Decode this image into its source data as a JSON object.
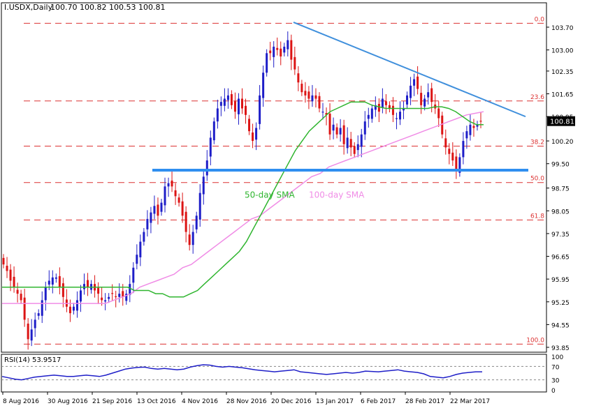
{
  "header": {
    "symbol": "I.USDX,Daily",
    "ohlc": "100.70 100.82 100.53 100.81"
  },
  "colors": {
    "bull": "#1e1ec8",
    "bear": "#dc1414",
    "sma50": "#2fb52f",
    "sma100": "#f08ce6",
    "trendline": "#3f8fdc",
    "support": "#2f8ff0",
    "fib": "#dc3232",
    "rsi": "#1e1ec8",
    "price_tag_bg": "#000000"
  },
  "chart_data": {
    "type": "candlestick",
    "symbol": "I.USDX",
    "timeframe": "Daily",
    "ylim": [
      93.7,
      104.15
    ],
    "y_ticks": [
      "103.70",
      "103.00",
      "102.35",
      "101.65",
      "100.95",
      "100.20",
      "99.50",
      "98.75",
      "98.05",
      "97.35",
      "96.65",
      "95.95",
      "95.25",
      "94.55",
      "93.85"
    ],
    "x_ticks": [
      "8 Aug 2016",
      "30 Aug 2016",
      "21 Sep 2016",
      "13 Oct 2016",
      "4 Nov 2016",
      "28 Nov 2016",
      "20 Dec 2016",
      "13 Jan 2017",
      "6 Feb 2017",
      "28 Feb 2017",
      "22 Mar 2017"
    ],
    "last_price": "100.81",
    "closes": [
      96.4,
      96.2,
      95.9,
      95.7,
      95.5,
      95.3,
      94.7,
      94.1,
      94.4,
      94.7,
      94.9,
      95.3,
      95.7,
      95.9,
      96.0,
      96.0,
      95.7,
      95.4,
      95.1,
      94.9,
      95.1,
      95.3,
      95.6,
      95.8,
      95.7,
      95.8,
      95.6,
      95.5,
      95.3,
      95.3,
      95.4,
      95.5,
      95.4,
      95.5,
      95.4,
      95.5,
      95.8,
      96.3,
      96.7,
      97.1,
      97.4,
      97.8,
      98.0,
      98.2,
      97.9,
      98.3,
      98.8,
      98.9,
      98.8,
      98.5,
      98.3,
      97.9,
      97.4,
      97.0,
      97.4,
      97.9,
      98.6,
      99.1,
      99.6,
      100.3,
      100.8,
      101.2,
      101.4,
      101.5,
      101.6,
      101.3,
      101.1,
      101.5,
      101.2,
      101.0,
      100.5,
      100.2,
      100.6,
      101.6,
      102.3,
      102.9,
      102.9,
      103.1,
      103.0,
      102.8,
      103.1,
      103.3,
      102.7,
      102.4,
      102.0,
      101.7,
      101.6,
      101.5,
      101.6,
      101.5,
      101.2,
      101.1,
      101.0,
      100.4,
      100.7,
      100.4,
      100.6,
      100.1,
      100.3,
      100.0,
      99.8,
      100.1,
      100.4,
      100.8,
      101.0,
      101.2,
      101.3,
      101.1,
      101.5,
      101.3,
      101.2,
      101.0,
      100.9,
      101.1,
      101.2,
      101.6,
      101.9,
      102.1,
      101.8,
      101.3,
      101.5,
      101.7,
      101.4,
      101.2,
      100.9,
      100.4,
      100.0,
      99.8,
      99.6,
      99.3,
      99.7,
      100.2,
      100.5,
      100.7,
      100.6,
      100.7,
      100.81
    ],
    "sma50": [
      95.7,
      95.7,
      95.7,
      95.7,
      95.7,
      95.7,
      95.7,
      95.7,
      95.7,
      95.7,
      95.7,
      95.7,
      95.7,
      95.7,
      95.7,
      95.7,
      95.7,
      95.7,
      95.7,
      95.6,
      95.6,
      95.6,
      95.5,
      95.5,
      95.4,
      95.4,
      95.4,
      95.5,
      95.6,
      95.8,
      96.0,
      96.2,
      96.4,
      96.6,
      96.8,
      97.1,
      97.5,
      97.9,
      98.3,
      98.7,
      99.1,
      99.5,
      99.9,
      100.2,
      100.5,
      100.7,
      100.9,
      101.1,
      101.2,
      101.3,
      101.4,
      101.4,
      101.4,
      101.3,
      101.25,
      101.2,
      101.2,
      101.2,
      101.2,
      101.2,
      101.2,
      101.2,
      101.25,
      101.25,
      101.2,
      101.1,
      100.95,
      100.8,
      100.7,
      100.7
    ],
    "sma100": [
      95.2,
      95.2,
      95.2,
      95.2,
      95.2,
      95.2,
      95.2,
      95.2,
      95.2,
      95.2,
      95.2,
      95.2,
      95.2,
      95.3,
      95.4,
      95.5,
      95.7,
      95.8,
      95.9,
      96.0,
      96.1,
      96.3,
      96.4,
      96.6,
      96.8,
      97.0,
      97.2,
      97.4,
      97.6,
      97.8,
      97.9,
      98.1,
      98.3,
      98.5,
      98.7,
      98.9,
      99.1,
      99.2,
      99.4,
      99.5,
      99.6,
      99.7,
      99.8,
      99.9,
      100.0,
      100.1,
      100.2,
      100.3,
      100.4,
      100.5,
      100.6,
      100.7,
      100.8,
      100.9,
      101.0,
      101.05,
      101.1
    ],
    "fib_levels": [
      {
        "label": "0.0",
        "price": 103.82
      },
      {
        "label": "23.6",
        "price": 101.43
      },
      {
        "label": "38.2",
        "price": 100.04
      },
      {
        "label": "50.0",
        "price": 98.92
      },
      {
        "label": "61.8",
        "price": 97.77
      },
      {
        "label": "100.0",
        "price": 93.95
      }
    ],
    "annotations": {
      "sma50_label": "50-day SMA",
      "sma100_label": "100-day SMA"
    },
    "rsi": {
      "label": "RSI(14) 53.9517",
      "ylim": [
        0,
        100
      ],
      "ticks": [
        "100",
        "70",
        "30",
        "0"
      ],
      "levels": [
        70,
        30
      ],
      "values": [
        40,
        36,
        32,
        30,
        34,
        38,
        40,
        42,
        44,
        42,
        40,
        40,
        42,
        44,
        42,
        40,
        44,
        50,
        56,
        62,
        65,
        67,
        68,
        64,
        62,
        64,
        62,
        60,
        62,
        68,
        72,
        75,
        74,
        70,
        68,
        70,
        68,
        66,
        63,
        60,
        58,
        56,
        54,
        56,
        58,
        60,
        54,
        52,
        50,
        48,
        46,
        48,
        50,
        52,
        50,
        52,
        56,
        55,
        54,
        56,
        58,
        60,
        56,
        54,
        52,
        48,
        40,
        38,
        36,
        40,
        46,
        50,
        52,
        54,
        54
      ]
    }
  }
}
